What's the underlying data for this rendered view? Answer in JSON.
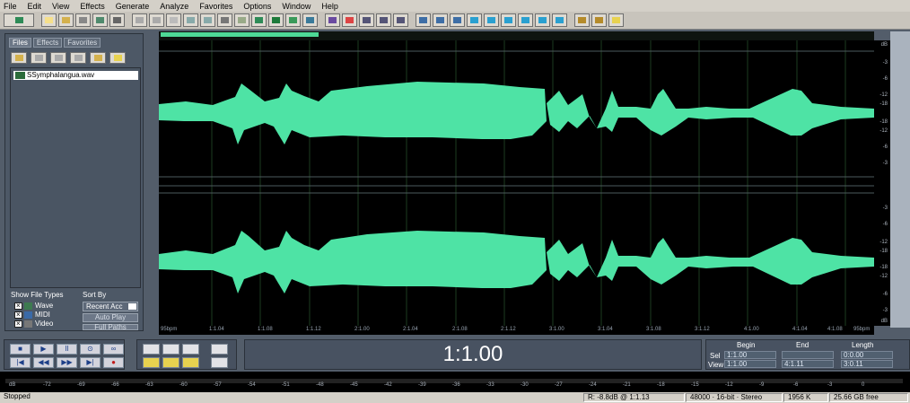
{
  "menu": [
    "File",
    "Edit",
    "View",
    "Effects",
    "Generate",
    "Analyze",
    "Favorites",
    "Options",
    "Window",
    "Help"
  ],
  "left_panel": {
    "tabs": [
      "Files",
      "Effects",
      "Favorites"
    ],
    "file_item": "SSymphalangua.wav",
    "show_file_types_label": "Show File Types",
    "sort_by_label": "Sort By",
    "types": [
      "Wave",
      "MIDI",
      "Video"
    ],
    "sort_value": "Recent Acc",
    "auto_play": "Auto Play",
    "full_paths": "Full Paths"
  },
  "scale": {
    "db": "dB",
    "top_labels": [
      "-3",
      "-6",
      "-12",
      "-18",
      "-18",
      "-12",
      "-6",
      "-3"
    ],
    "bottom_labels": [
      "-3",
      "-6",
      "-12",
      "-18",
      "-18",
      "-12",
      "-6",
      "-3"
    ],
    "db_bottom": "dB"
  },
  "timeline": [
    "95bpm",
    "1:1.04",
    "1:1.08",
    "1:1.12",
    "2:1.00",
    "2:1.04",
    "2:1.08",
    "2:1.12",
    "3:1.00",
    "3:1.04",
    "3:1.08",
    "3:1.12",
    "4:1.00",
    "4:1.04",
    "4:1.08",
    "95bpm"
  ],
  "time_display": "1:1.00",
  "selection": {
    "headers": [
      "Begin",
      "End",
      "Length"
    ],
    "rows": [
      {
        "label": "Sel",
        "begin": "1:1.00",
        "end": "",
        "length": "0:0.00"
      },
      {
        "label": "View",
        "begin": "1:1.00",
        "end": "4:1.11",
        "length": "3:0.11"
      }
    ]
  },
  "meter_labels": [
    "dB",
    "-72",
    "-69",
    "-66",
    "-63",
    "-60",
    "-57",
    "-54",
    "-51",
    "-48",
    "-45",
    "-42",
    "-39",
    "-36",
    "-33",
    "-30",
    "-27",
    "-24",
    "-21",
    "-18",
    "-15",
    "-12",
    "-9",
    "-6",
    "-3",
    "0"
  ],
  "status": {
    "state": "Stopped",
    "readout": "R: -8.8dB @ 1:1.13",
    "format": "48000 · 16-bit · Stereo",
    "size": "1956 K",
    "free": "25.66 GB free"
  },
  "colors": {
    "wave": "#4ee3a5",
    "bg": "#000000",
    "panel": "#535d6a"
  }
}
